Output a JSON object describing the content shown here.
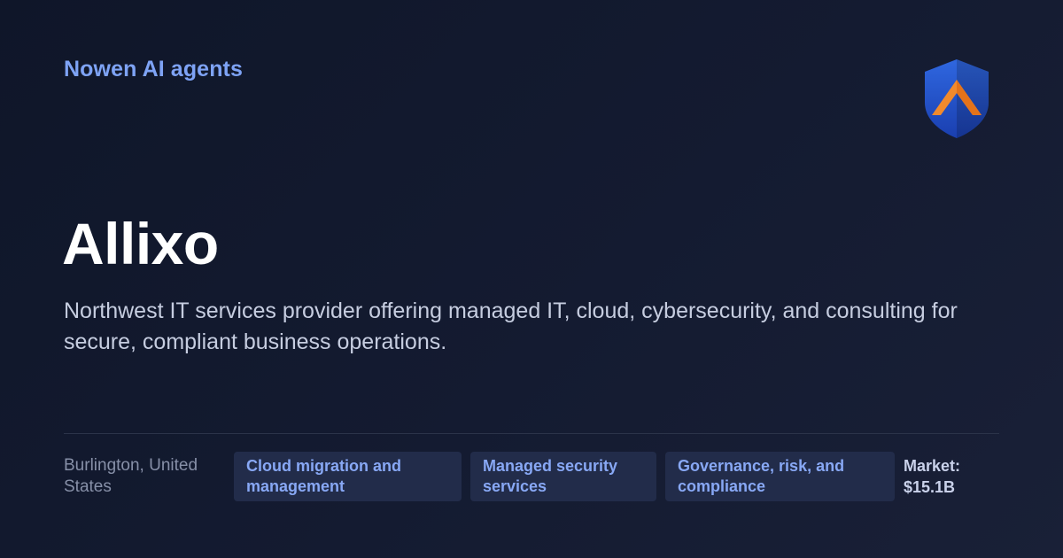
{
  "brand": {
    "name": "Nowen AI agents"
  },
  "logo": {
    "icon": "shield-chevron-icon",
    "colors": {
      "shield": "#1f4fc4",
      "chevron": "#f28a2c"
    }
  },
  "company": {
    "name": "Allixo",
    "description": "Northwest IT services provider offering managed IT, cloud, cybersecurity, and consulting for secure, compliant business operations.",
    "location": "Burlington, United States",
    "tags": [
      "Cloud migration and management",
      "Managed security services",
      "Governance, risk, and compliance"
    ],
    "market": "Market: $15.1B"
  },
  "colors": {
    "background": "#111830",
    "accent": "#7ea3f5",
    "tag_background": "#222c4a"
  }
}
